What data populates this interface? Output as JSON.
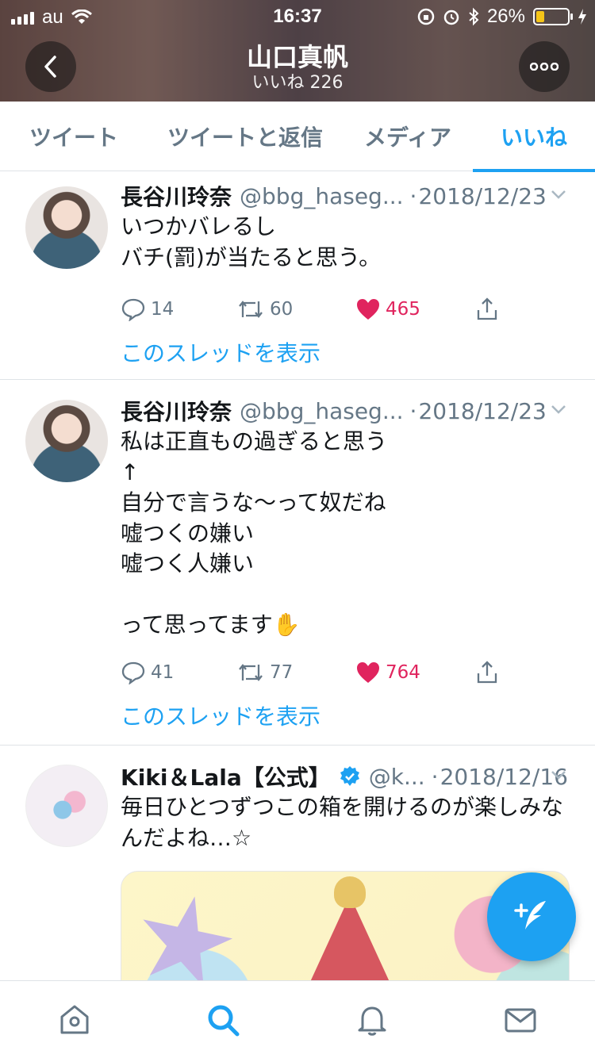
{
  "status_bar": {
    "carrier": "au",
    "time": "16:37",
    "battery": "26%",
    "battery_level": 0.26
  },
  "header": {
    "title": "山口真帆",
    "subtitle": "いいね 226"
  },
  "tabs": [
    {
      "label": "ツイート",
      "active": false
    },
    {
      "label": "ツイートと返信",
      "active": false
    },
    {
      "label": "メディア",
      "active": false
    },
    {
      "label": "いいね",
      "active": true
    }
  ],
  "tweets": [
    {
      "name": "長谷川玲奈",
      "handle": "@bbg_haseg...",
      "date": "2018/12/23",
      "text": "いつかバレるし\nバチ(罰)が当たると思う。",
      "replies": "14",
      "retweets": "60",
      "likes": "465",
      "thread_link": "このスレッドを表示"
    },
    {
      "name": "長谷川玲奈",
      "handle": "@bbg_haseg...",
      "date": "2018/12/23",
      "text": "私は正直もの過ぎると思う\n↑\n自分で言うな〜って奴だね\n嘘つくの嫌い\n嘘つく人嫌い\n\nって思ってます✋",
      "replies": "41",
      "retweets": "77",
      "likes": "764",
      "thread_link": "このスレッドを表示"
    },
    {
      "name": "Kiki＆Lala【公式】",
      "handle": "@k...",
      "date": "2018/12/16",
      "text": "毎日ひとつずつこの箱を開けるのが楽しみなんだよね…☆",
      "verified": true
    }
  ],
  "colors": {
    "accent": "#1da1f2",
    "like": "#e0245e",
    "muted": "#657786"
  },
  "icons": {
    "back": "chevron-left-icon",
    "more": "more-icon",
    "reply": "reply-icon",
    "retweet": "retweet-icon",
    "like": "heart-icon",
    "share": "share-icon",
    "compose": "compose-icon",
    "home": "home-icon",
    "search": "search-icon",
    "notifications": "bell-icon",
    "messages": "mail-icon"
  }
}
